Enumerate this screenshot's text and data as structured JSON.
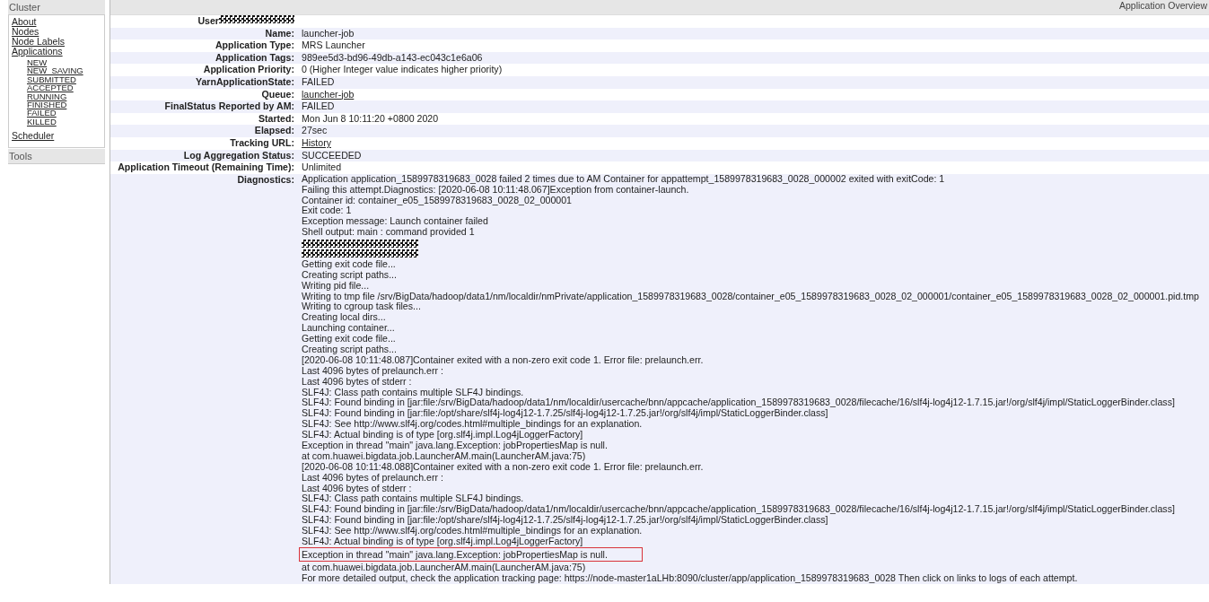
{
  "sidebar": {
    "header": "Cluster",
    "items": [
      {
        "label": "About"
      },
      {
        "label": "Nodes"
      },
      {
        "label": "Node Labels"
      },
      {
        "label": "Applications",
        "children": [
          {
            "label": "NEW"
          },
          {
            "label": "NEW_SAVING"
          },
          {
            "label": "SUBMITTED"
          },
          {
            "label": "ACCEPTED"
          },
          {
            "label": "RUNNING"
          },
          {
            "label": "FINISHED"
          },
          {
            "label": "FAILED"
          },
          {
            "label": "KILLED"
          }
        ]
      },
      {
        "label": "Scheduler"
      }
    ],
    "footer": "Tools"
  },
  "overview": {
    "title": "Application Overview",
    "rows": [
      {
        "label": "User",
        "kind": "redacted"
      },
      {
        "label": "Name:",
        "kind": "text",
        "value": "launcher-job"
      },
      {
        "label": "Application Type:",
        "kind": "text",
        "value": "MRS Launcher"
      },
      {
        "label": "Application Tags:",
        "kind": "text",
        "value": "989ee5d3-bd96-49db-a143-ec043c1e6a06"
      },
      {
        "label": "Application Priority:",
        "kind": "text",
        "value": "0 (Higher Integer value indicates higher priority)"
      },
      {
        "label": "YarnApplicationState:",
        "kind": "text",
        "value": "FAILED"
      },
      {
        "label": "Queue:",
        "kind": "link",
        "value": "launcher-job"
      },
      {
        "label": "FinalStatus Reported by AM:",
        "kind": "text",
        "value": "FAILED"
      },
      {
        "label": "Started:",
        "kind": "text",
        "value": "Mon Jun 8 10:11:20 +0800 2020"
      },
      {
        "label": "Elapsed:",
        "kind": "text",
        "value": "27sec"
      },
      {
        "label": "Tracking URL:",
        "kind": "link",
        "value": "History"
      },
      {
        "label": "Log Aggregation Status:",
        "kind": "text",
        "value": "SUCCEEDED"
      },
      {
        "label": "Application Timeout (Remaining Time):",
        "kind": "text",
        "value": "Unlimited"
      },
      {
        "label": "Diagnostics:",
        "kind": "lines",
        "lines": [
          {
            "kind": "text",
            "text": "Application application_1589978319683_0028 failed 2 times due to AM Container for appattempt_1589978319683_0028_000002 exited with exitCode: 1"
          },
          {
            "kind": "text",
            "text": "Failing this attempt.Diagnostics: [2020-06-08 10:11:48.067]Exception from container-launch."
          },
          {
            "kind": "text",
            "text": "Container id: container_e05_1589978319683_0028_02_000001"
          },
          {
            "kind": "text",
            "text": "Exit code: 1"
          },
          {
            "kind": "text",
            "text": "Exception message: Launch container failed"
          },
          {
            "kind": "text",
            "text": "Shell output: main : command provided 1"
          },
          {
            "kind": "redacted"
          },
          {
            "kind": "redacted"
          },
          {
            "kind": "text",
            "text": "Getting exit code file..."
          },
          {
            "kind": "text",
            "text": "Creating script paths..."
          },
          {
            "kind": "text",
            "text": "Writing pid file..."
          },
          {
            "kind": "text",
            "text": "Writing to tmp file /srv/BigData/hadoop/data1/nm/localdir/nmPrivate/application_1589978319683_0028/container_e05_1589978319683_0028_02_000001/container_e05_1589978319683_0028_02_000001.pid.tmp"
          },
          {
            "kind": "text",
            "text": "Writing to cgroup task files..."
          },
          {
            "kind": "text",
            "text": "Creating local dirs..."
          },
          {
            "kind": "text",
            "text": "Launching container..."
          },
          {
            "kind": "text",
            "text": "Getting exit code file..."
          },
          {
            "kind": "text",
            "text": "Creating script paths..."
          },
          {
            "kind": "text",
            "text": "[2020-06-08 10:11:48.087]Container exited with a non-zero exit code 1. Error file: prelaunch.err."
          },
          {
            "kind": "text",
            "text": "Last 4096 bytes of prelaunch.err :"
          },
          {
            "kind": "text",
            "text": "Last 4096 bytes of stderr :"
          },
          {
            "kind": "text",
            "text": "SLF4J: Class path contains multiple SLF4J bindings."
          },
          {
            "kind": "text",
            "text": "SLF4J: Found binding in [jar:file:/srv/BigData/hadoop/data1/nm/localdir/usercache/bnn/appcache/application_1589978319683_0028/filecache/16/slf4j-log4j12-1.7.15.jar!/org/slf4j/impl/StaticLoggerBinder.class]"
          },
          {
            "kind": "text",
            "text": "SLF4J: Found binding in [jar:file:/opt/share/slf4j-log4j12-1.7.25/slf4j-log4j12-1.7.25.jar!/org/slf4j/impl/StaticLoggerBinder.class]"
          },
          {
            "kind": "text",
            "text": "SLF4J: See http://www.slf4j.org/codes.html#multiple_bindings for an explanation."
          },
          {
            "kind": "text",
            "text": "SLF4J: Actual binding is of type [org.slf4j.impl.Log4jLoggerFactory]"
          },
          {
            "kind": "text",
            "text": "Exception in thread \"main\" java.lang.Exception: jobPropertiesMap is null."
          },
          {
            "kind": "text",
            "text": "at com.huawei.bigdata.job.LauncherAM.main(LauncherAM.java:75)"
          },
          {
            "kind": "text",
            "text": "[2020-06-08 10:11:48.088]Container exited with a non-zero exit code 1. Error file: prelaunch.err."
          },
          {
            "kind": "text",
            "text": "Last 4096 bytes of prelaunch.err :"
          },
          {
            "kind": "text",
            "text": "Last 4096 bytes of stderr :"
          },
          {
            "kind": "text",
            "text": "SLF4J: Class path contains multiple SLF4J bindings."
          },
          {
            "kind": "text",
            "text": "SLF4J: Found binding in [jar:file:/srv/BigData/hadoop/data1/nm/localdir/usercache/bnn/appcache/application_1589978319683_0028/filecache/16/slf4j-log4j12-1.7.15.jar!/org/slf4j/impl/StaticLoggerBinder.class]"
          },
          {
            "kind": "text",
            "text": "SLF4J: Found binding in [jar:file:/opt/share/slf4j-log4j12-1.7.25/slf4j-log4j12-1.7.25.jar!/org/slf4j/impl/StaticLoggerBinder.class]"
          },
          {
            "kind": "text",
            "text": "SLF4J: See http://www.slf4j.org/codes.html#multiple_bindings for an explanation."
          },
          {
            "kind": "text",
            "text": "SLF4J: Actual binding is of type [org.slf4j.impl.Log4jLoggerFactory]"
          },
          {
            "kind": "highlighted",
            "text": "Exception in thread \"main\" java.lang.Exception: jobPropertiesMap is null."
          },
          {
            "kind": "text",
            "text": "at com.huawei.bigdata.job.LauncherAM.main(LauncherAM.java:75)"
          },
          {
            "kind": "text",
            "text": "For more detailed output, check the application tracking page: https://node-master1aLHb:8090/cluster/app/application_1589978319683_0028 Then click on links to logs of each attempt."
          }
        ]
      }
    ]
  }
}
